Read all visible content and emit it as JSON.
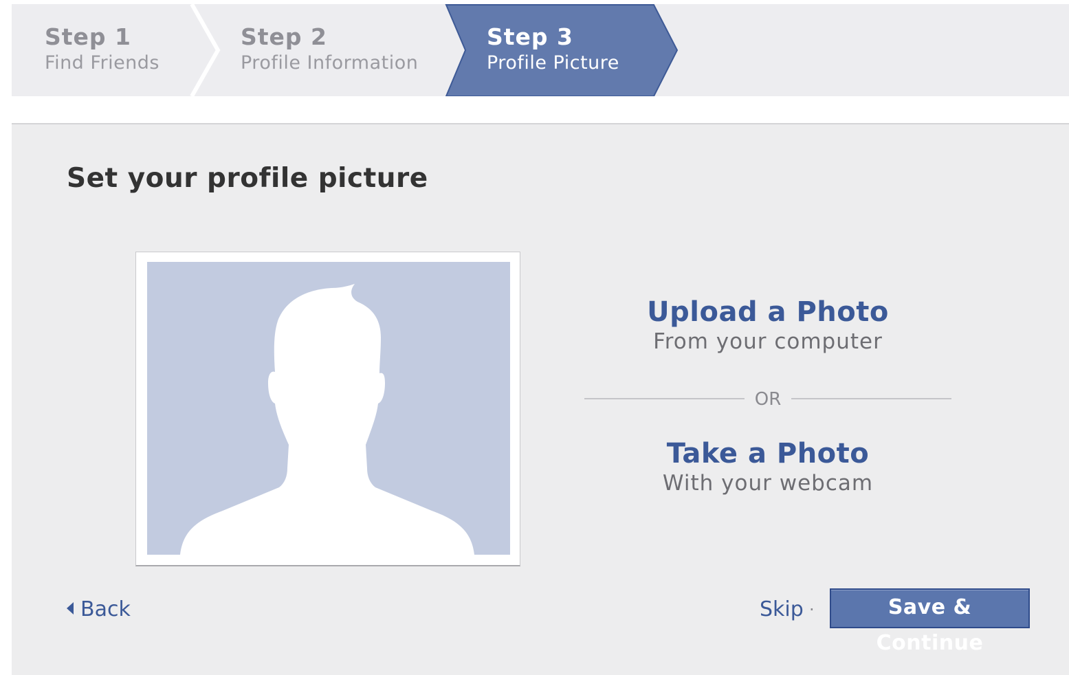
{
  "steps": [
    {
      "number": "Step 1",
      "name": "Find Friends",
      "active": false
    },
    {
      "number": "Step 2",
      "name": "Profile Information",
      "active": false
    },
    {
      "number": "Step 3",
      "name": "Profile Picture",
      "active": true
    }
  ],
  "panel": {
    "title": "Set your profile picture"
  },
  "photo": {
    "icon": "default-profile-silhouette-icon"
  },
  "upload": {
    "title": "Upload a Photo",
    "subtitle": "From your computer"
  },
  "separator": {
    "label": "OR"
  },
  "webcam": {
    "title": "Take a Photo",
    "subtitle": "With your webcam"
  },
  "footer": {
    "back_label": "Back",
    "skip_label": "Skip",
    "separator_dot": "·",
    "save_label": "Save & Continue"
  },
  "colors": {
    "accent": "#3b5998",
    "active_step": "#627aad",
    "button": "#5b76ad",
    "silhouette_bg": "#c2cbe0",
    "panel_bg": "#ededee"
  }
}
